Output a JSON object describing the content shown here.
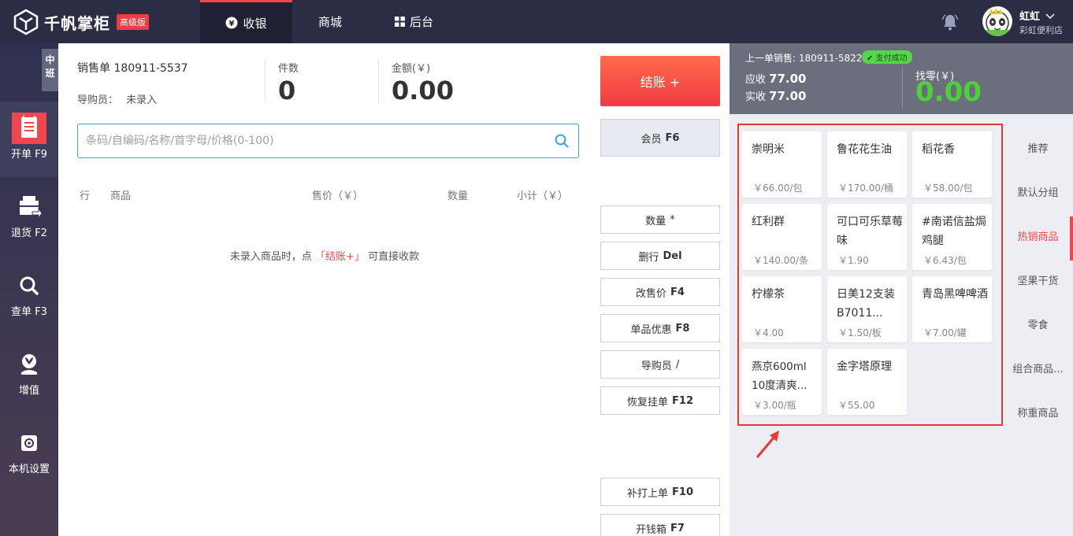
{
  "header": {
    "logo_text": "千帆掌柜",
    "edition": "高级版",
    "nav": [
      {
        "label": "收银",
        "icon": "yen-circle-icon"
      },
      {
        "label": "商城"
      },
      {
        "label": "后台",
        "icon": "grid-icon"
      }
    ],
    "user": {
      "name": "虹虹",
      "store": "彩虹便利店"
    }
  },
  "sidebar": {
    "shift": "中班",
    "items": [
      {
        "label": "开单 F9",
        "icon": "receipt-icon"
      },
      {
        "label": "退货 F2",
        "icon": "return-box-icon"
      },
      {
        "label": "查单 F3",
        "icon": "search-icon"
      },
      {
        "label": "增值",
        "icon": "sprout-icon"
      },
      {
        "label": "本机设置",
        "icon": "gear-icon"
      }
    ]
  },
  "order": {
    "no_label": "销售单 180911-5537",
    "guide_label": "导购员：",
    "guide_value": "未录入",
    "count_label": "件数",
    "count_value": "0",
    "amount_label": "金额(￥)",
    "amount_value": "0.00"
  },
  "search": {
    "placeholder": "条码/自编码/名称/首字母/价格(0-100)"
  },
  "table": {
    "headers": [
      "行",
      "商品",
      "售价（￥）",
      "数量",
      "小计（￥）"
    ],
    "empty_hint_pre": "未录入商品时，点",
    "empty_hint_hl": "「结账+」",
    "empty_hint_post": "可直接收款"
  },
  "actions": {
    "checkout": "结账 +",
    "member": {
      "label": "会员",
      "key": "F6"
    },
    "buttons": [
      {
        "label": "数量",
        "key": "*"
      },
      {
        "label": "删行",
        "key": "Del"
      },
      {
        "label": "改售价",
        "key": "F4"
      },
      {
        "label": "单品优惠",
        "key": "F8"
      },
      {
        "label": "导购员",
        "key": "/"
      },
      {
        "label": "恢复挂单",
        "key": "F12"
      },
      {
        "label": "补打上单",
        "key": "F10"
      },
      {
        "label": "开钱箱",
        "key": "F7"
      }
    ]
  },
  "last_sale": {
    "title": "上一单销售: 180911-5822",
    "status": "支付成功",
    "receivable_label": "应收",
    "receivable": "77.00",
    "paid_label": "实收",
    "paid": "77.00",
    "change_label": "找零(￥)",
    "change": "0.00"
  },
  "products": [
    {
      "name": "崇明米",
      "price": "￥66.00/包"
    },
    {
      "name": "鲁花花生油",
      "price": "￥170.00/桶"
    },
    {
      "name": "稻花香",
      "price": "￥58.00/包"
    },
    {
      "name": "红利群",
      "price": "￥140.00/条"
    },
    {
      "name": "可口可乐草莓味",
      "price": "￥1.90"
    },
    {
      "name": "#南诺信盐焗鸡腿",
      "price": "￥6.43/包"
    },
    {
      "name": "柠檬茶",
      "price": "￥4.00"
    },
    {
      "name": "日美12支装B7011...",
      "price": "￥1.50/板"
    },
    {
      "name": "青岛黑啤啤酒",
      "price": "￥7.00/罐"
    },
    {
      "name": "燕京600ml 10度清爽...",
      "price": "￥3.00/瓶"
    },
    {
      "name": "金字塔原理",
      "price": "￥55.00"
    }
  ],
  "categories": [
    "推荐",
    "默认分组",
    "热销商品",
    "坚果干货",
    "零食",
    "组合商品...",
    "称重商品"
  ],
  "colors": {
    "accent": "#f0474d",
    "topbar": "#2b2d45",
    "success": "#4cd137",
    "highlight_box": "#e53935"
  }
}
